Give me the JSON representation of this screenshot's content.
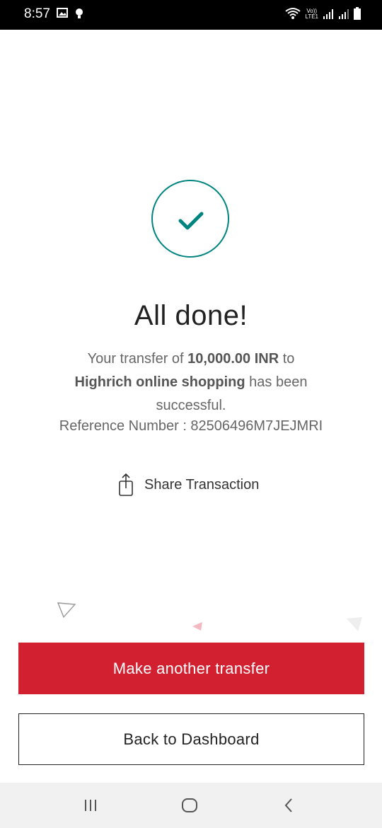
{
  "status_bar": {
    "time": "8:57",
    "network_label_top": "Vo))",
    "network_label_bottom": "LTE1"
  },
  "result": {
    "title": "All done!",
    "message_prefix": "Your transfer of ",
    "amount": "10,000.00 INR",
    "message_middle": " to ",
    "payee": "Highrich online shopping",
    "message_suffix": " has been successful.",
    "reference": "Reference Number : 82506496M7JEJMRI"
  },
  "share": {
    "label": "Share Transaction"
  },
  "actions": {
    "primary_label": "Make another transfer",
    "secondary_label": "Back to Dashboard"
  },
  "colors": {
    "accent_teal": "#00847f",
    "primary_red": "#d32030"
  },
  "icons": {
    "success": "checkmark-circle",
    "share": "share-upload-icon",
    "nav": [
      "recent-apps-icon",
      "home-icon",
      "back-icon"
    ]
  }
}
